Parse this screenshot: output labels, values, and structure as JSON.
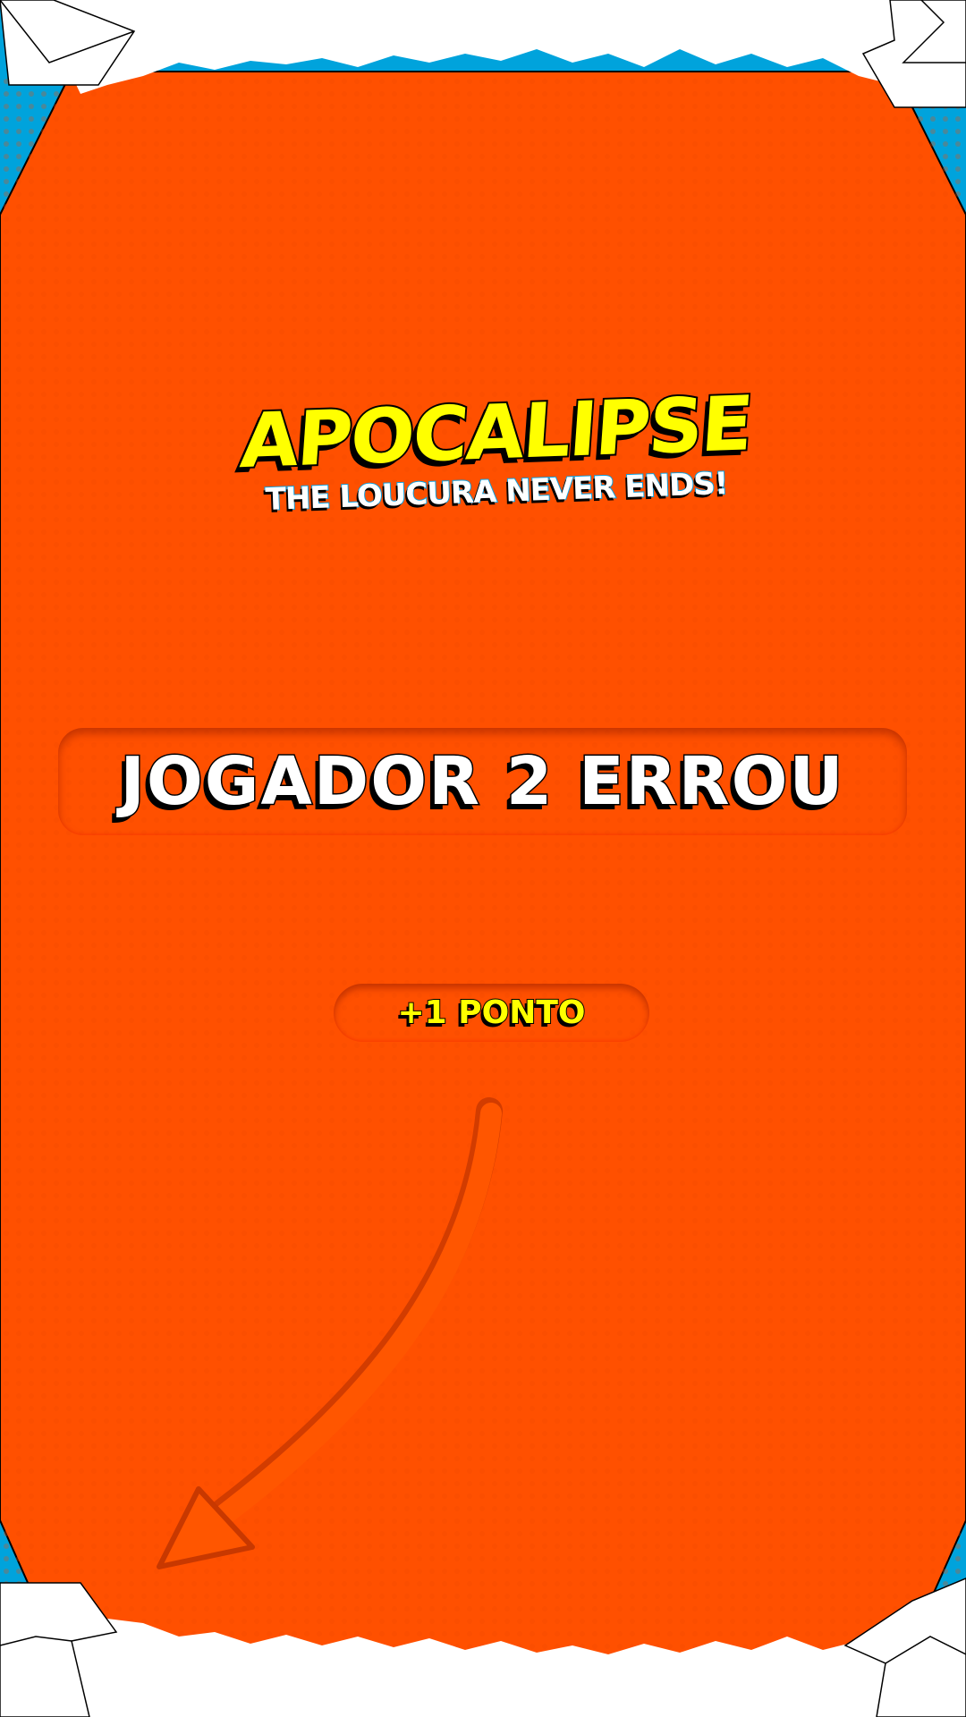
{
  "logo": {
    "title": "APOCALIPSE",
    "subtitle": "THE LOUCURA NEVER ENDS!"
  },
  "message": "JOGADOR 2 ERROU",
  "points_badge": "+1 PONTO",
  "colors": {
    "background_orange": "#ff5000",
    "frame_blue": "#00a3dc",
    "paper_white": "#ffffff",
    "logo_yellow": "#ffff00"
  }
}
